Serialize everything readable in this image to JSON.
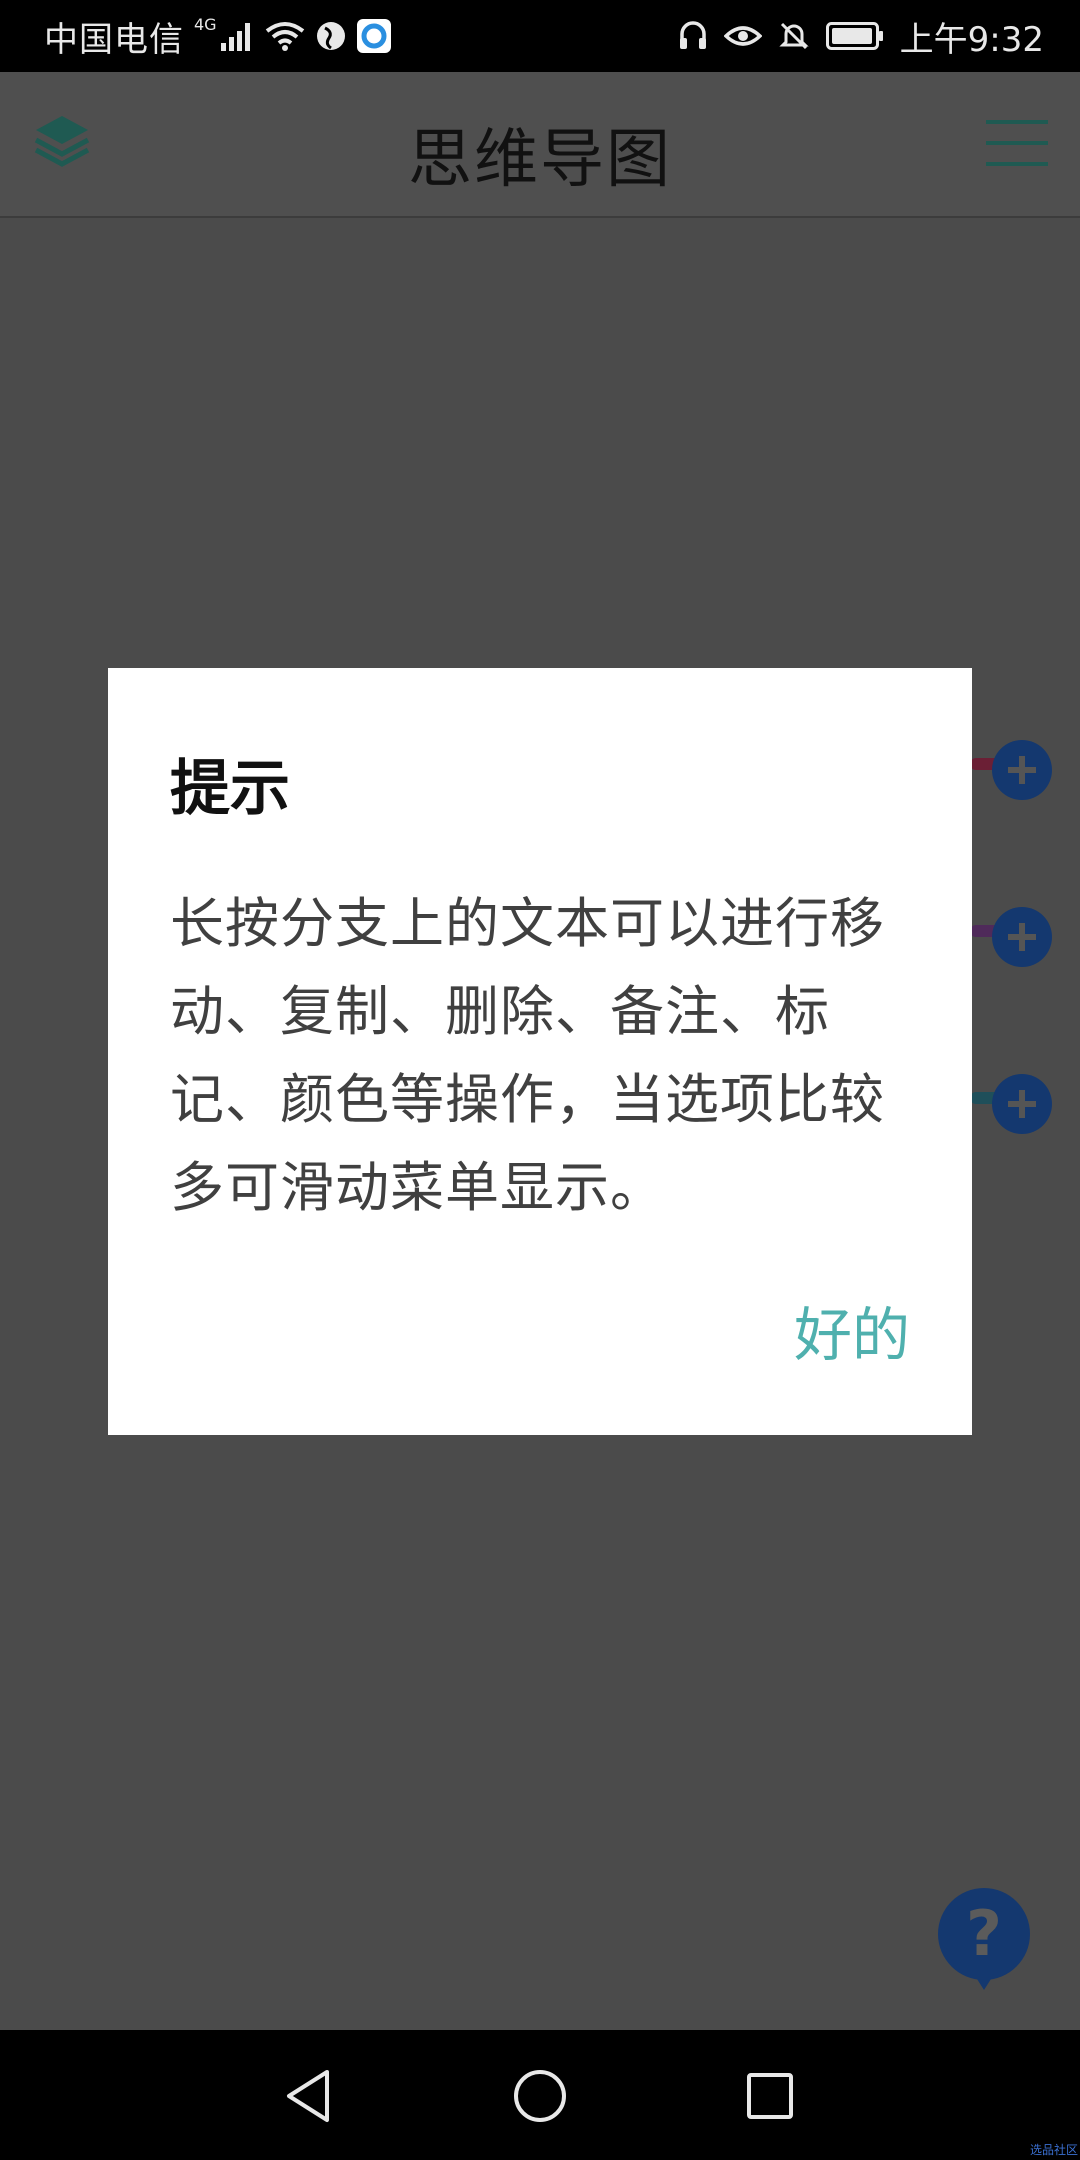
{
  "status_bar": {
    "carrier": "中国电信",
    "network_type": "4G",
    "time": "上午9:32",
    "icons": [
      "signal-icon",
      "wifi-icon",
      "vpn-globe-icon",
      "app-notification-icon",
      "headset-icon",
      "eye-icon",
      "notification-muted-icon",
      "battery-icon"
    ]
  },
  "header": {
    "title": "思维导图",
    "left_icon": "layers-icon",
    "right_icon": "menu-icon"
  },
  "canvas": {
    "branches": [
      {
        "color": "#6b1f35"
      },
      {
        "color": "#4f2a5a"
      },
      {
        "color": "#1f4f5a"
      }
    ],
    "help_icon": "help-icon",
    "help_label": "?"
  },
  "dialog": {
    "title": "提示",
    "message": "长按分支上的文本可以进行移动、复制、删除、备注、标记、颜色等操作，当选项比较多可滑动菜单显示。",
    "ok_label": "好的",
    "accent_color": "#4fb0ae"
  },
  "nav_bar": {
    "icons": [
      "back-icon",
      "home-icon",
      "recents-icon"
    ]
  },
  "watermark": "选品社区"
}
